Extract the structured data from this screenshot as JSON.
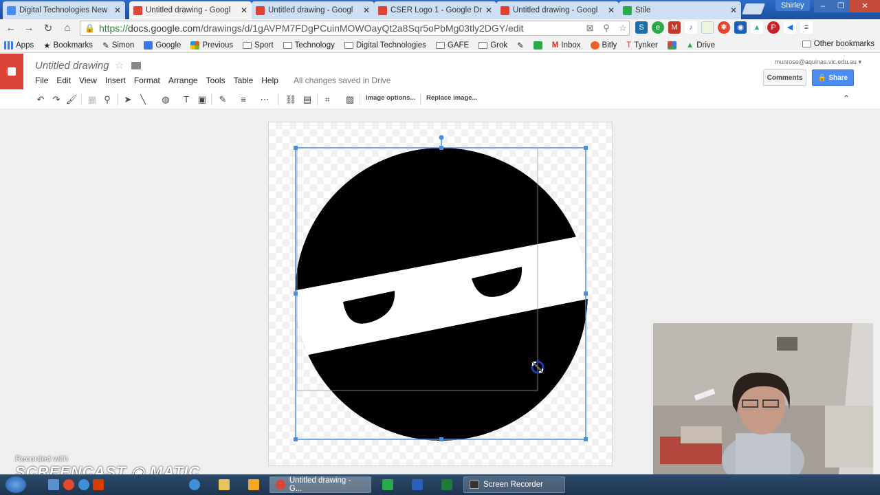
{
  "browser": {
    "tabs": [
      {
        "title": "Digital Technologies New",
        "favicon_color": "#4a8cf0",
        "active": false
      },
      {
        "title": "Untitled drawing - Googl",
        "favicon_color": "#db4437",
        "active": true
      },
      {
        "title": "Untitled drawing - Googl",
        "favicon_color": "#db4437",
        "active": false
      },
      {
        "title": "CSER Logo 1 - Google Dr",
        "favicon_color": "#db4437",
        "active": false
      },
      {
        "title": "Untitled drawing - Googl",
        "favicon_color": "#db4437",
        "active": false
      },
      {
        "title": "Stile",
        "favicon_color": "#2aa84a",
        "active": false
      }
    ],
    "profile_name": "Shirley",
    "url_scheme": "https://",
    "url_host": "docs.google.com",
    "url_path": "/drawings/d/1gAVPM7FDgPCuinMOWOayQt2a8Sqr5oPbMg03tly2DGY/edit",
    "bookmarks": [
      {
        "label": "Apps",
        "icon": "apps-grid-icon"
      },
      {
        "label": "Bookmarks",
        "icon": "star-icon"
      },
      {
        "label": "Simon",
        "icon": "pencil-icon"
      },
      {
        "label": "Google",
        "icon": "google-icon"
      },
      {
        "label": "Previous",
        "icon": "windows-icon"
      },
      {
        "label": "Sport",
        "icon": "folder-icon"
      },
      {
        "label": "Technology",
        "icon": "folder-icon"
      },
      {
        "label": "Digital Technologies",
        "icon": "folder-icon"
      },
      {
        "label": "GAFE",
        "icon": "folder-icon"
      },
      {
        "label": "Grok",
        "icon": "folder-icon"
      },
      {
        "label": "",
        "icon": "pencil-icon"
      },
      {
        "label": "",
        "icon": "green-app-icon"
      },
      {
        "label": "Inbox",
        "icon": "gmail-icon"
      },
      {
        "label": "Bitly",
        "icon": "bitly-icon"
      },
      {
        "label": "Tynker",
        "icon": "tynker-icon"
      },
      {
        "label": "",
        "icon": "puzzle-icon"
      },
      {
        "label": "Drive",
        "icon": "drive-icon"
      }
    ],
    "other_bookmarks": "Other bookmarks"
  },
  "docs": {
    "title": "Untitled drawing",
    "menu": [
      "File",
      "Edit",
      "View",
      "Insert",
      "Format",
      "Arrange",
      "Tools",
      "Table",
      "Help"
    ],
    "save_status": "All changes saved in Drive",
    "account": "munrose@aquinas.vic.edu.au",
    "comments_label": "Comments",
    "share_label": "Share",
    "toolbar": {
      "image_options_label": "Image options...",
      "replace_image_label": "Replace image..."
    }
  },
  "watermark": {
    "recorded_with": "Recorded with",
    "brand": "SCREENCAST ◉ MATIC"
  },
  "taskbar": {
    "tasks": [
      {
        "label": "Untitled drawing - G...",
        "icon_color": "#db4437"
      },
      {
        "label": "Screen Recorder",
        "icon_color": "#333333"
      }
    ]
  }
}
